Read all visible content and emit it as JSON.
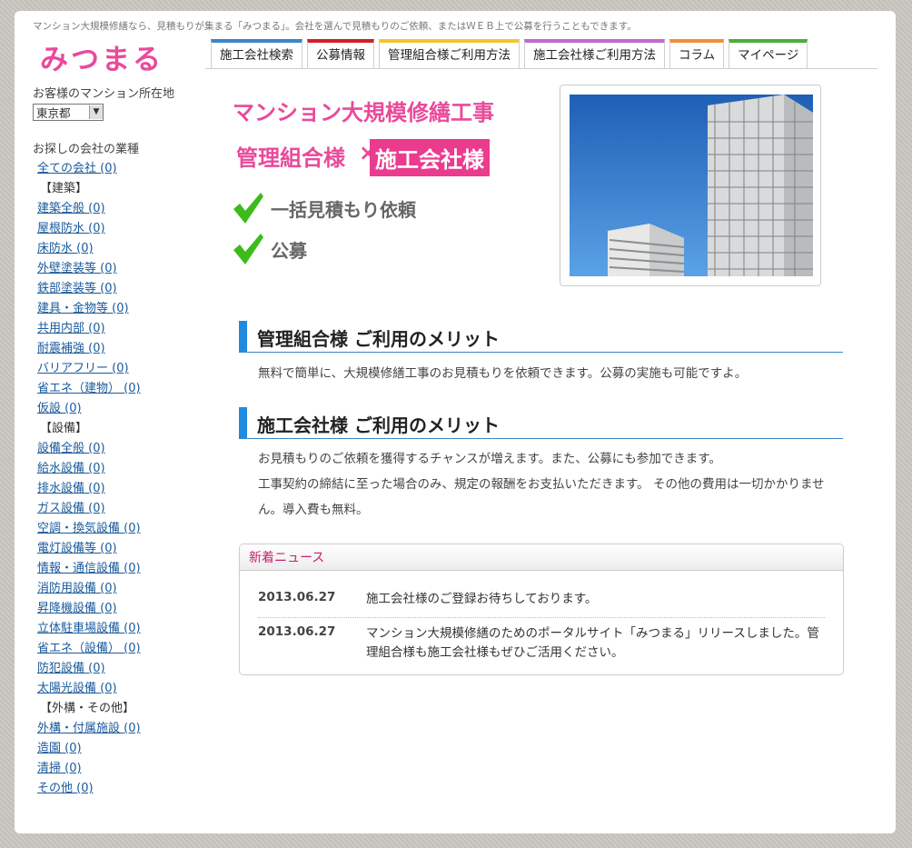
{
  "header": {
    "tagline": "マンション大規模修繕なら、見積もりが集まる「みつまる」。会社を選んで見積もりのご依頼、またはＷＥＢ上で公募を行うこともできます。",
    "logo": "みつまる"
  },
  "nav": {
    "tabs": [
      {
        "label": "施工会社検索",
        "color": "#3a87c8"
      },
      {
        "label": "公募情報",
        "color": "#d0202a"
      },
      {
        "label": "管理組合様ご利用方法",
        "color": "#f4c430"
      },
      {
        "label": "施工会社様ご利用方法",
        "color": "#c06ad0"
      },
      {
        "label": "コラム",
        "color": "#f09030"
      },
      {
        "label": "マイページ",
        "color": "#4cae3c"
      }
    ]
  },
  "sidebar": {
    "location_label": "お客様のマンション所在地",
    "location_value": "東京都",
    "industry_label": "お探しの会社の業種",
    "items": [
      {
        "type": "link",
        "label": "全ての会社 (0)"
      },
      {
        "type": "group",
        "label": "【建築】"
      },
      {
        "type": "link",
        "label": "建築全般 (0)"
      },
      {
        "type": "link",
        "label": "屋根防水 (0)"
      },
      {
        "type": "link",
        "label": "床防水 (0)"
      },
      {
        "type": "link",
        "label": "外壁塗装等 (0)"
      },
      {
        "type": "link",
        "label": "鉄部塗装等 (0)"
      },
      {
        "type": "link",
        "label": "建具・金物等 (0)"
      },
      {
        "type": "link",
        "label": "共用内部 (0)"
      },
      {
        "type": "link",
        "label": "耐震補強 (0)"
      },
      {
        "type": "link",
        "label": "バリアフリー (0)"
      },
      {
        "type": "link",
        "label": "省エネ（建物） (0)"
      },
      {
        "type": "link",
        "label": "仮設 (0)"
      },
      {
        "type": "group",
        "label": "【設備】"
      },
      {
        "type": "link",
        "label": "設備全般 (0)"
      },
      {
        "type": "link",
        "label": "給水設備 (0)"
      },
      {
        "type": "link",
        "label": "排水設備 (0)"
      },
      {
        "type": "link",
        "label": "ガス設備 (0)"
      },
      {
        "type": "link",
        "label": "空調・換気設備 (0)"
      },
      {
        "type": "link",
        "label": "電灯設備等 (0)"
      },
      {
        "type": "link",
        "label": "情報・通信設備 (0)"
      },
      {
        "type": "link",
        "label": "消防用設備 (0)"
      },
      {
        "type": "link",
        "label": "昇降機設備 (0)"
      },
      {
        "type": "link",
        "label": "立体駐車場設備 (0)"
      },
      {
        "type": "link",
        "label": "省エネ（設備） (0)"
      },
      {
        "type": "link",
        "label": "防犯設備 (0)"
      },
      {
        "type": "link",
        "label": "太陽光設備 (0)"
      },
      {
        "type": "group",
        "label": "【外構・その他】"
      },
      {
        "type": "link",
        "label": "外構・付属施設 (0)"
      },
      {
        "type": "link",
        "label": "造園 (0)"
      },
      {
        "type": "link",
        "label": "清掃 (0)"
      },
      {
        "type": "link",
        "label": "その他 (0)"
      }
    ]
  },
  "hero": {
    "title": "マンション大規模修繕工事",
    "left": "管理組合様",
    "times": "×",
    "right": "施工会社様",
    "check1": "一括見積もり依頼",
    "check2": "公募"
  },
  "main": {
    "sec1_title": "管理組合様 ご利用のメリット",
    "sec1_text": "無料で簡単に、大規模修繕工事のお見積もりを依頼できます。公募の実施も可能ですよ。",
    "sec2_title": "施工会社様 ご利用のメリット",
    "sec2_line1": "お見積もりのご依頼を獲得するチャンスが増えます。また、公募にも参加できます。",
    "sec2_line2": "工事契約の締結に至った場合のみ、規定の報酬をお支払いただきます。 その他の費用は一切かかりません。導入費も無料。"
  },
  "news": {
    "title": "新着ニュース",
    "items": [
      {
        "date": "2013.06.27",
        "text": "施工会社様のご登録お待ちしております。"
      },
      {
        "date": "2013.06.27",
        "text": "マンション大規模修繕のためのポータルサイト「みつまる」リリースしました。管理組合様も施工会社様もぜひご活用ください。"
      }
    ]
  },
  "colors": {
    "pink": "#e94a9a",
    "blue_accent": "#1e8be0",
    "link": "#1a5a9c"
  }
}
